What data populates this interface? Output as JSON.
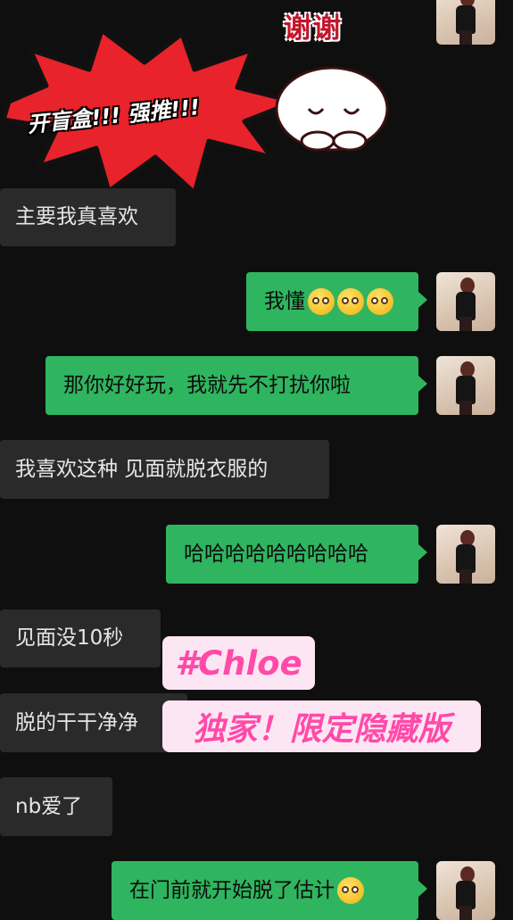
{
  "sticker": {
    "thanks_text": "谢谢",
    "burst_text": "开盲盒!!! 强推!!!"
  },
  "messages": [
    {
      "side": "in",
      "text": "主要我真喜欢"
    },
    {
      "side": "out",
      "text": "我懂",
      "emoji_count": 3,
      "emoji": "nervous-face-emoji"
    },
    {
      "side": "out",
      "text": "那你好好玩，我就先不打扰你啦"
    },
    {
      "side": "in",
      "text": "我喜欢这种 见面就脱衣服的"
    },
    {
      "side": "out",
      "text": "哈哈哈哈哈哈哈哈哈"
    },
    {
      "side": "in",
      "text": "见面没10秒"
    },
    {
      "side": "in",
      "text": "脱的干干净净"
    },
    {
      "side": "in",
      "text": "nb爱了"
    },
    {
      "side": "out",
      "text": "在门前就开始脱了估计",
      "emoji": "laughing-tears-emoji"
    }
  ],
  "overlay_tags": {
    "tag1": "#Chloe",
    "tag2": "独家！限定隐藏版"
  },
  "colors": {
    "background": "#0f0f0f",
    "incoming_bubble": "#2a2a2a",
    "outgoing_bubble": "#2fb55f",
    "tag_text": "#ff4aa8",
    "tag_bg": "#fde6f3",
    "burst": "#e8232b"
  }
}
